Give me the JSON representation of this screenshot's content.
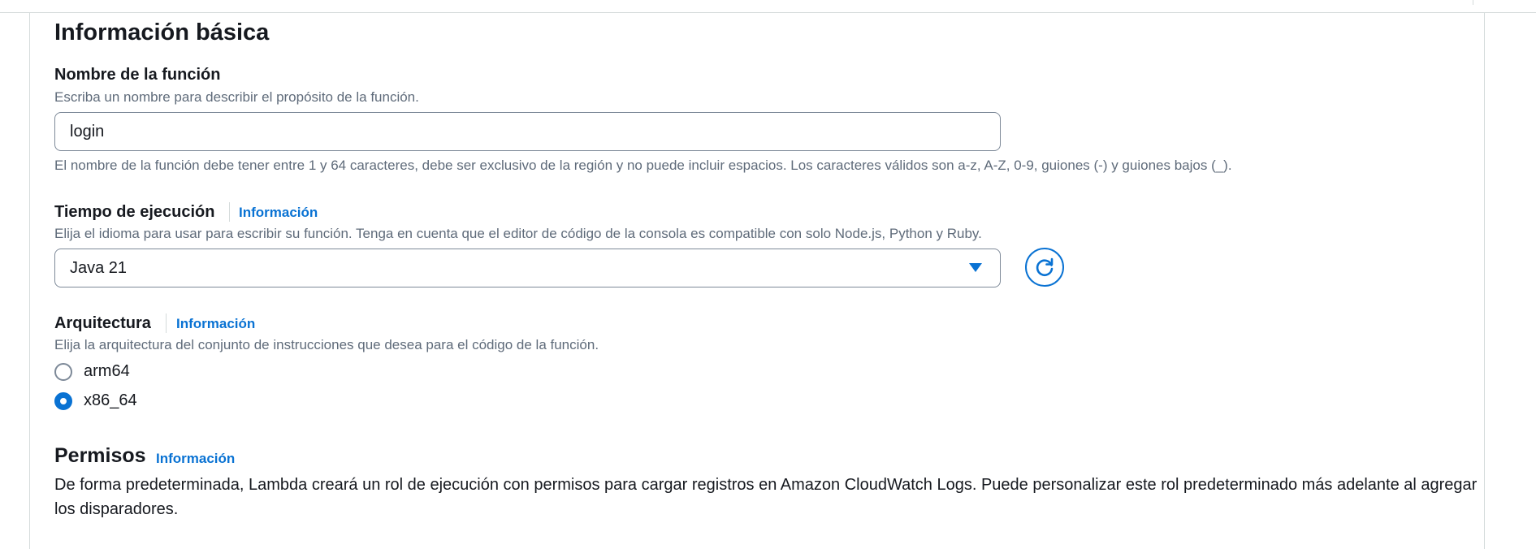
{
  "section": {
    "title": "Información básica"
  },
  "function_name": {
    "label": "Nombre de la función",
    "description": "Escriba un nombre para describir el propósito de la función.",
    "value": "login",
    "constraint": "El nombre de la función debe tener entre 1 y 64 caracteres, debe ser exclusivo de la región y no puede incluir espacios. Los caracteres válidos son a-z, A-Z, 0-9, guiones (-) y guiones bajos (_)."
  },
  "runtime": {
    "label": "Tiempo de ejecución",
    "info_link": "Información",
    "description": "Elija el idioma para usar para escribir su función. Tenga en cuenta que el editor de código de la consola es compatible con solo Node.js, Python y Ruby.",
    "selected": "Java 21",
    "refresh_icon": "refresh-icon"
  },
  "architecture": {
    "label": "Arquitectura",
    "info_link": "Información",
    "description": "Elija la arquitectura del conjunto de instrucciones que desea para el código de la función.",
    "options": [
      {
        "label": "arm64",
        "checked": false
      },
      {
        "label": "x86_64",
        "checked": true
      }
    ]
  },
  "permissions": {
    "title": "Permisos",
    "info_link": "Información",
    "body": "De forma predeterminada, Lambda creará un rol de ejecución con permisos para cargar registros en Amazon CloudWatch Logs. Puede personalizar este rol predeterminado más adelante al agregar los disparadores."
  },
  "colors": {
    "accent": "#0972d3",
    "text": "#16191f",
    "muted": "#5f6b7a",
    "border": "#7d8998"
  }
}
